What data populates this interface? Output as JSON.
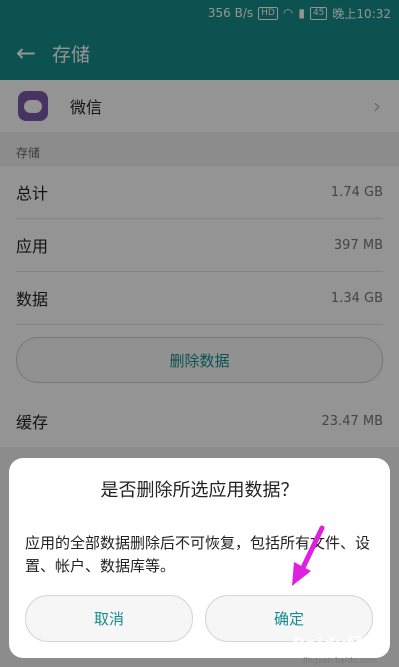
{
  "status_bar": {
    "speed": "356 B/s",
    "hd_badge": "HD",
    "battery": "45",
    "time": "晚上10:32"
  },
  "app_bar": {
    "title": "存储"
  },
  "app": {
    "name": "微信"
  },
  "section": {
    "label": "存储"
  },
  "storage_rows": [
    {
      "label": "总计",
      "value": "1.74 GB"
    },
    {
      "label": "应用",
      "value": "397 MB"
    },
    {
      "label": "数据",
      "value": "1.34 GB"
    }
  ],
  "clear_data_button": "删除数据",
  "cache": {
    "label": "缓存",
    "value": "23.47 MB"
  },
  "dialog": {
    "title": "是否删除所选应用数据？",
    "message": "应用的全部数据删除后不可恢复，包括所有文件、设置、帐户、数据库等。",
    "cancel_label": "取消",
    "confirm_label": "确定"
  },
  "watermark": {
    "text": "Baidu经验",
    "sub": "jingyan.baidu.com"
  },
  "colors": {
    "accent": "#148d8b",
    "arrow": "#e020e0"
  }
}
